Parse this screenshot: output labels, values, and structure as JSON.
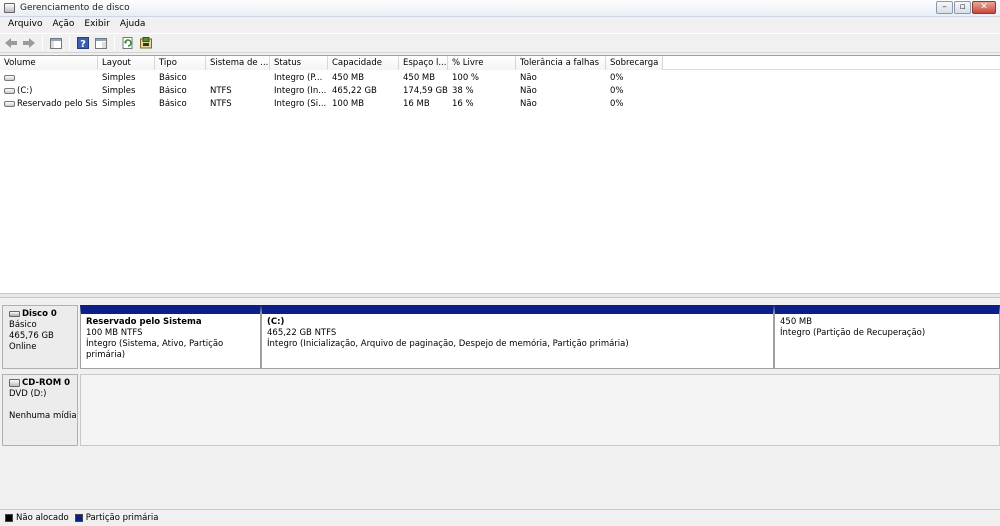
{
  "window": {
    "title": "Gerenciamento de disco"
  },
  "menu": [
    "Arquivo",
    "Ação",
    "Exibir",
    "Ajuda"
  ],
  "toolbar": [
    "back-arrow-icon",
    "forward-arrow-icon",
    "properties-icon",
    "help-icon",
    "console-tree-icon",
    "refresh-icon",
    "rescan-icon"
  ],
  "columns": [
    "Volume",
    "Layout",
    "Tipo",
    "Sistema de ...",
    "Status",
    "Capacidade",
    "Espaço l...",
    "% Livre",
    "Tolerância a falhas",
    "Sobrecarga"
  ],
  "volumes": [
    {
      "volume": "",
      "layout": "Simples",
      "tipo": "Básico",
      "sistema": "",
      "status": "Íntegro (P...",
      "capacidade": "450 MB",
      "espaco": "450 MB",
      "livre": "100 %",
      "tolerancia": "Não",
      "sobrecarga": "0%"
    },
    {
      "volume": "(C:)",
      "layout": "Simples",
      "tipo": "Básico",
      "sistema": "NTFS",
      "status": "Íntegro (In...",
      "capacidade": "465,22 GB",
      "espaco": "174,59 GB",
      "livre": "38 %",
      "tolerancia": "Não",
      "sobrecarga": "0%"
    },
    {
      "volume": "Reservado pelo Sis...",
      "layout": "Simples",
      "tipo": "Básico",
      "sistema": "NTFS",
      "status": "Íntegro (Si...",
      "capacidade": "100 MB",
      "espaco": "16 MB",
      "livre": "16 %",
      "tolerancia": "Não",
      "sobrecarga": "0%"
    }
  ],
  "disks": [
    {
      "name": "Disco 0",
      "type": "Básico",
      "size": "465,76 GB",
      "state": "Online",
      "partitions": [
        {
          "name": "Reservado pelo Sistema",
          "size": "100 MB NTFS",
          "status": "Íntegro (Sistema, Ativo, Partição primária)"
        },
        {
          "name": "(C:)",
          "size": "465,22 GB NTFS",
          "status": "Íntegro (Inicialização, Arquivo de paginação, Despejo de memória, Partição primária)"
        },
        {
          "name": "",
          "size": "450 MB",
          "status": "Íntegro (Partição de Recuperação)"
        }
      ]
    },
    {
      "name": "CD-ROM 0",
      "type": "DVD (D:)",
      "size": "",
      "state": "Nenhuma mídia"
    }
  ],
  "legend": [
    {
      "label": "Não alocado",
      "color": "#000000"
    },
    {
      "label": "Partição primária",
      "color": "#0b1e8a"
    }
  ]
}
